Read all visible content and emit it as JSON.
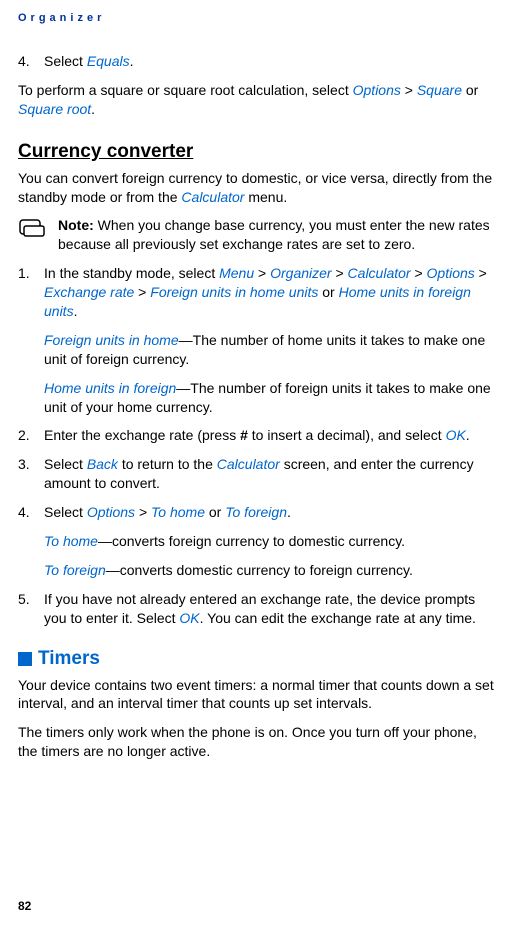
{
  "header": {
    "title": "Organizer"
  },
  "step4a": {
    "num": "4.",
    "pre": "Select ",
    "eq": "Equals",
    "post": "."
  },
  "square_para": {
    "t1": "To perform a square or square root calculation, select ",
    "opt": "Options",
    "gt1": " > ",
    "sq": "Square",
    "or1": " or ",
    "sr": "Square root",
    "t2": "."
  },
  "currency_heading": "Currency converter",
  "currency_intro": {
    "t1": "You can convert foreign currency to domestic, or vice versa, directly from the standby mode or from the ",
    "calc": "Calculator",
    "t2": " menu."
  },
  "note": {
    "bold": "Note:",
    "text": " When you change base currency, you must enter the new rates because all previously set exchange rates are set to zero."
  },
  "s1": {
    "num": "1.",
    "t1": "In the standby mode, select ",
    "menu": "Menu",
    "gt1": " > ",
    "org": "Organizer",
    "gt2": " > ",
    "calc": "Calculator",
    "gt3": " > ",
    "opt": "Options",
    "gt4": " > ",
    "er": "Exchange rate",
    "gt5": " > ",
    "fuh": "Foreign units in home units",
    "or": " or ",
    "huf": "Home units in foreign units",
    "t2": "."
  },
  "s1a": {
    "label": "Foreign units in home",
    "text": "—The number of home units it takes to make one unit of foreign currency."
  },
  "s1b": {
    "label": "Home units in foreign",
    "text": "—The number of foreign units it takes to make one unit of your home currency."
  },
  "s2": {
    "num": "2.",
    "t1": "Enter the exchange rate (press ",
    "hash": "#",
    "t2": " to insert a decimal), and select ",
    "ok": "OK",
    "t3": "."
  },
  "s3": {
    "num": "3.",
    "t1": "Select ",
    "back": "Back",
    "t2": " to return to the ",
    "calc": "Calculator",
    "t3": " screen, and enter the currency amount to convert."
  },
  "s4": {
    "num": "4.",
    "t1": "Select ",
    "opt": "Options",
    "gt": " > ",
    "th": "To home",
    "or": " or ",
    "tf": "To foreign",
    "t2": "."
  },
  "s4a": {
    "label": "To home",
    "text": "—converts foreign currency to domestic currency."
  },
  "s4b": {
    "label": "To foreign",
    "text": "—converts domestic currency to foreign currency."
  },
  "s5": {
    "num": "5.",
    "t1": "If you have not already entered an exchange rate, the device prompts you to enter it. Select ",
    "ok": "OK",
    "t2": ". You can edit the exchange rate at any time."
  },
  "timers_heading": "Timers",
  "timers_p1": "Your device contains two event timers: a normal timer that counts down a set interval, and an interval timer that counts up set intervals.",
  "timers_p2": "The timers only work when the phone is on. Once you turn off your phone, the timers are no longer active.",
  "page_num": "82"
}
